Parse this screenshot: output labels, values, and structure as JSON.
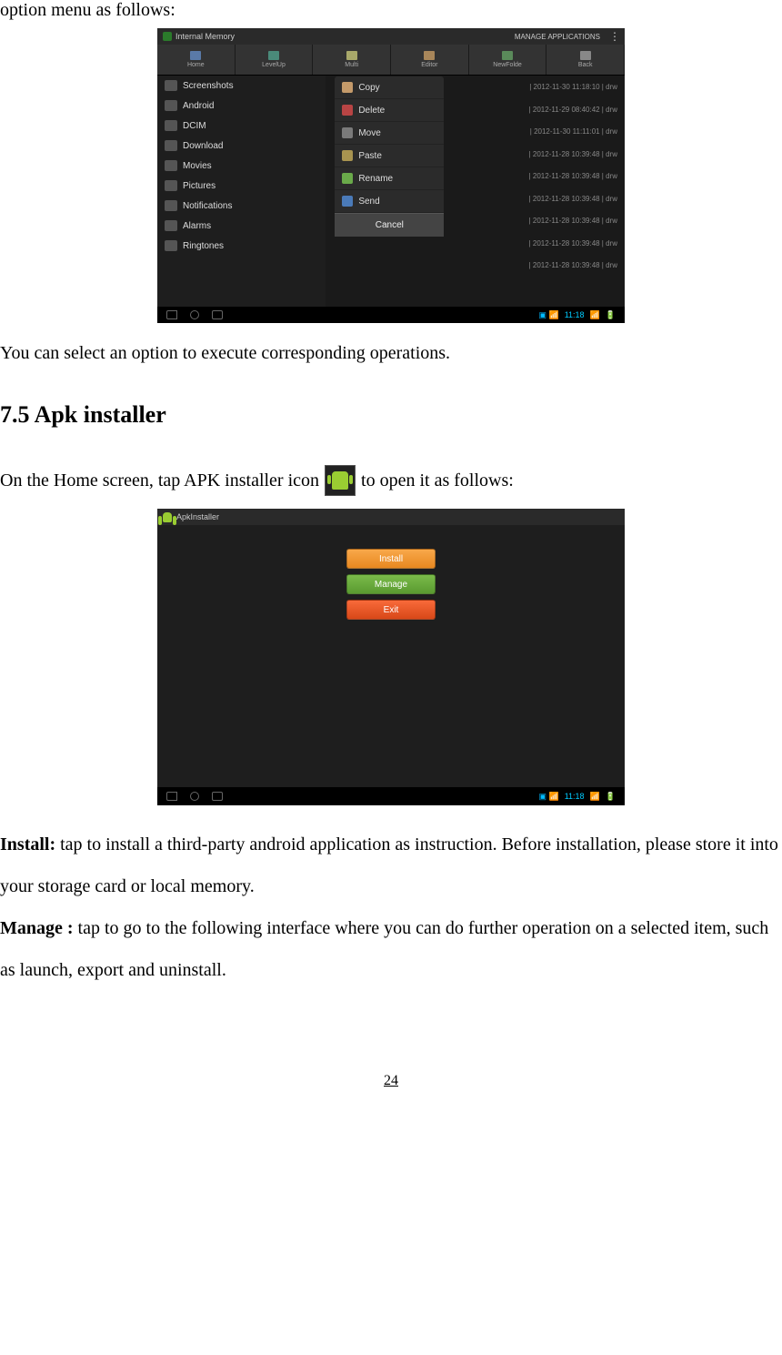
{
  "intro": "option menu as follows:",
  "ss1": {
    "title": "Internal Memory",
    "manage": "MANAGE APPLICATIONS",
    "tools": [
      "Home",
      "LevelUp",
      "Multi",
      "Editor",
      "NewFolde",
      "Back"
    ],
    "folders": [
      "Screenshots",
      "Android",
      "DCIM",
      "Download",
      "Movies",
      "Pictures",
      "Notifications",
      "Alarms",
      "Ringtones"
    ],
    "menu": [
      "Copy",
      "Delete",
      "Move",
      "Paste",
      "Rename",
      "Send"
    ],
    "cancel": "Cancel",
    "meta": [
      "| 2012-11-30 11:18:10 | drw",
      "| 2012-11-29 08:40:42 | drw",
      "| 2012-11-30 11:11:01 | drw",
      "| 2012-11-28 10:39:48 | drw",
      "| 2012-11-28 10:39:48 | drw",
      "| 2012-11-28 10:39:48 | drw",
      "| 2012-11-28 10:39:48 | drw",
      "| 2012-11-28 10:39:48 | drw",
      "| 2012-11-28 10:39:48 | drw"
    ],
    "time": "11:18"
  },
  "after_ss1": "You can select an option to execute corresponding operations.",
  "heading": "7.5 Apk installer",
  "apk_before": "On the Home screen, tap APK installer icon",
  "apk_after": "to open it as follows:",
  "ss2": {
    "title": "ApkInstaller",
    "install": "Install",
    "manage": "Manage",
    "exit": "Exit",
    "time": "11:18"
  },
  "install_bold": "Install:",
  "install_text": " tap to install a third-party android application as instruction. Before installation, please store it into your storage card or local memory.",
  "manage_bold": "Manage :",
  "manage_text": " tap to go to the following interface where you can do further operation on a selected item, such as launch, export and uninstall.",
  "page": "24"
}
